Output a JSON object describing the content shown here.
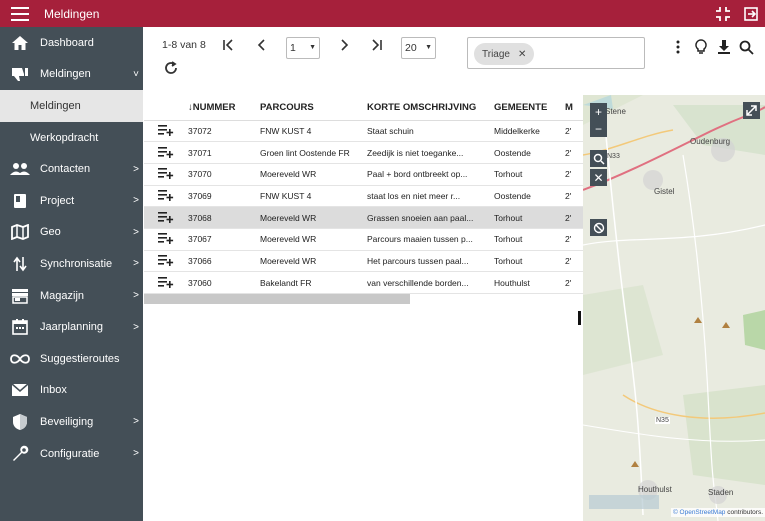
{
  "app": {
    "title": "Meldingen"
  },
  "sidebar": {
    "items": [
      {
        "label": "Dashboard",
        "icon": "home-icon",
        "chevron": ""
      },
      {
        "label": "Meldingen",
        "icon": "thumbs-down-icon",
        "chevron": "˅"
      },
      {
        "label": "Meldingen",
        "icon": "",
        "chevron": ""
      },
      {
        "label": "Werkopdracht",
        "icon": "",
        "chevron": ""
      },
      {
        "label": "Contacten",
        "icon": "people-icon",
        "chevron": ">"
      },
      {
        "label": "Project",
        "icon": "book-icon",
        "chevron": ">"
      },
      {
        "label": "Geo",
        "icon": "map-icon",
        "chevron": ">"
      },
      {
        "label": "Synchronisatie",
        "icon": "sync-arrows-icon",
        "chevron": ">"
      },
      {
        "label": "Magazijn",
        "icon": "store-icon",
        "chevron": ">"
      },
      {
        "label": "Jaarplanning",
        "icon": "calendar-icon",
        "chevron": ">"
      },
      {
        "label": "Suggestieroutes",
        "icon": "infinity-icon",
        "chevron": ""
      },
      {
        "label": "Inbox",
        "icon": "mail-icon",
        "chevron": ""
      },
      {
        "label": "Beveiliging",
        "icon": "shield-icon",
        "chevron": ">"
      },
      {
        "label": "Configuratie",
        "icon": "wrench-icon",
        "chevron": ">"
      }
    ]
  },
  "pager": {
    "range": "1-8 van 8",
    "page": "1",
    "page_size": "20"
  },
  "filter": {
    "chip_label": "Triage"
  },
  "table": {
    "headers": {
      "nummer": "NUMMER",
      "parcours": "PARCOURS",
      "kort": "KORTE OMSCHRIJVING",
      "gemeente": "GEMEENTE",
      "m": "M"
    },
    "rows": [
      {
        "nummer": "37072",
        "parcours": "FNW KUST 4",
        "kort": "Staat schuin",
        "gemeente": "Middelkerke",
        "m": "2'"
      },
      {
        "nummer": "37071",
        "parcours": "Groen lint Oostende FR",
        "kort": "Zeedijk is niet toeganke...",
        "gemeente": "Oostende",
        "m": "2'"
      },
      {
        "nummer": "37070",
        "parcours": "Moereveld WR",
        "kort": "Paal + bord ontbreekt op...",
        "gemeente": "Torhout",
        "m": "2'"
      },
      {
        "nummer": "37069",
        "parcours": "FNW KUST 4",
        "kort": "staat los en niet meer r...",
        "gemeente": "Oostende",
        "m": "2'"
      },
      {
        "nummer": "37068",
        "parcours": "Moereveld WR",
        "kort": "Grassen snoeien aan paal...",
        "gemeente": "Torhout",
        "m": "2'"
      },
      {
        "nummer": "37067",
        "parcours": "Moereveld WR",
        "kort": "Parcours maaien tussen p...",
        "gemeente": "Torhout",
        "m": "2'"
      },
      {
        "nummer": "37066",
        "parcours": "Moereveld WR",
        "kort": "Het parcours tussen paal...",
        "gemeente": "Torhout",
        "m": "2'"
      },
      {
        "nummer": "37060",
        "parcours": "Bakelandt FR",
        "kort": "van verschillende borden...",
        "gemeente": "Houthulst",
        "m": "2'"
      }
    ]
  },
  "map": {
    "labels": [
      "Stene",
      "Oudenburg",
      "Gistel",
      "N33",
      "N35",
      "Houthulst",
      "Staden"
    ],
    "attribution_link": "© OpenStreetMap",
    "attribution_rest": " contributors."
  },
  "colors": {
    "brand": "#a6203b",
    "sidebar": "#444f57",
    "selected_row": "#dcdcdc"
  }
}
